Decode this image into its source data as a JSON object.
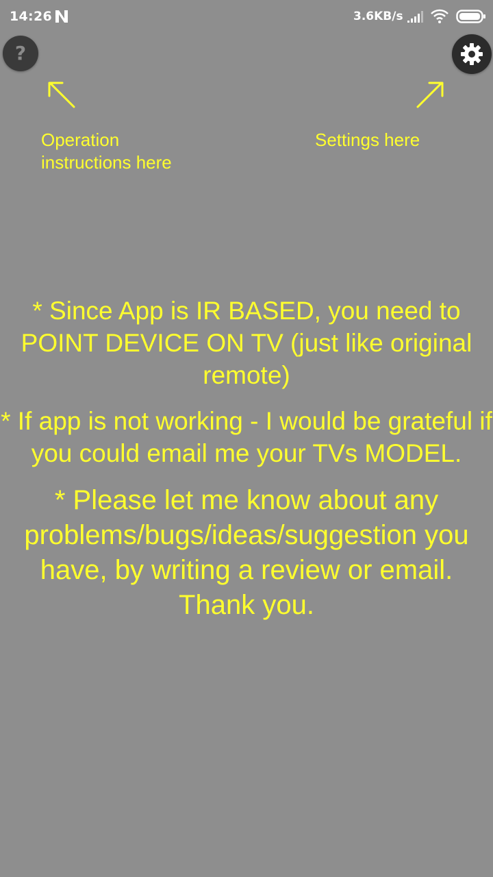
{
  "status_bar": {
    "time": "14:26",
    "net_speed": "3.6KB/s",
    "icons": [
      "notification-n-icon",
      "signal-icon",
      "wifi-icon",
      "battery-icon"
    ]
  },
  "toolbar": {
    "help_icon_glyph": "?",
    "help_icon": "question-icon",
    "settings_icon": "gear-icon"
  },
  "hints": {
    "operation": "Operation instructions here",
    "settings": "Settings here"
  },
  "messages": [
    "* Since App is IR BASED, you need to POINT DEVICE ON TV (just like original remote)",
    "* If app is not working - I would be grateful if you could email me your TVs MODEL.",
    "* Please let me know about any problems/bugs/ideas/suggestion you have, by writing a review or email. Thank you."
  ],
  "colors": {
    "background": "#8e8e8e",
    "text_accent": "#ffff2e",
    "button_bg": "#2b2b2b"
  }
}
